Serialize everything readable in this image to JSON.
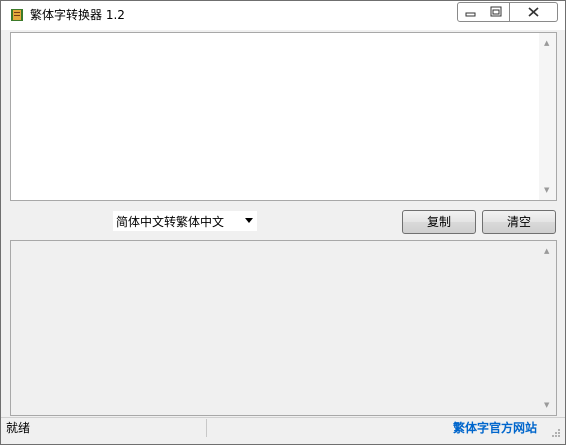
{
  "window": {
    "title": "繁体字转换器 1.2"
  },
  "icons": {
    "app": "book-icon",
    "minimize": "minimize-icon",
    "maximize": "maximize-icon",
    "close": "close-icon"
  },
  "input_area": {
    "value": ""
  },
  "output_area": {
    "value": ""
  },
  "conversion": {
    "selected": "简体中文转繁体中文"
  },
  "buttons": {
    "copy": "复制",
    "clear": "清空"
  },
  "status": {
    "text": "就绪",
    "link": "繁体字官方网站"
  },
  "colors": {
    "link": "#0066cc",
    "window_bg": "#f0f0f0"
  }
}
